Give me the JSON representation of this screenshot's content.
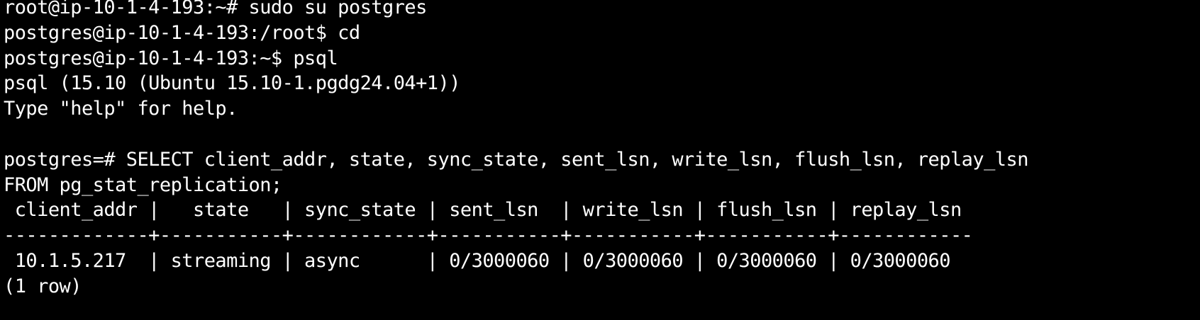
{
  "terminal": {
    "lines": [
      "root@ip-10-1-4-193:~# sudo su postgres",
      "postgres@ip-10-1-4-193:/root$ cd",
      "postgres@ip-10-1-4-193:~$ psql",
      "psql (15.10 (Ubuntu 15.10-1.pgdg24.04+1))",
      "Type \"help\" for help.",
      "",
      "postgres=# SELECT client_addr, state, sync_state, sent_lsn, write_lsn, flush_lsn, replay_lsn",
      "FROM pg_stat_replication;",
      " client_addr |   state   | sync_state | sent_lsn  | write_lsn | flush_lsn | replay_lsn",
      "-------------+-----------+------------+-----------+-----------+-----------+------------",
      " 10.1.5.217  | streaming | async      | 0/3000060 | 0/3000060 | 0/3000060 | 0/3000060",
      "(1 row)"
    ]
  },
  "colors": {
    "background": "#000000",
    "foreground": "#ffffff"
  }
}
